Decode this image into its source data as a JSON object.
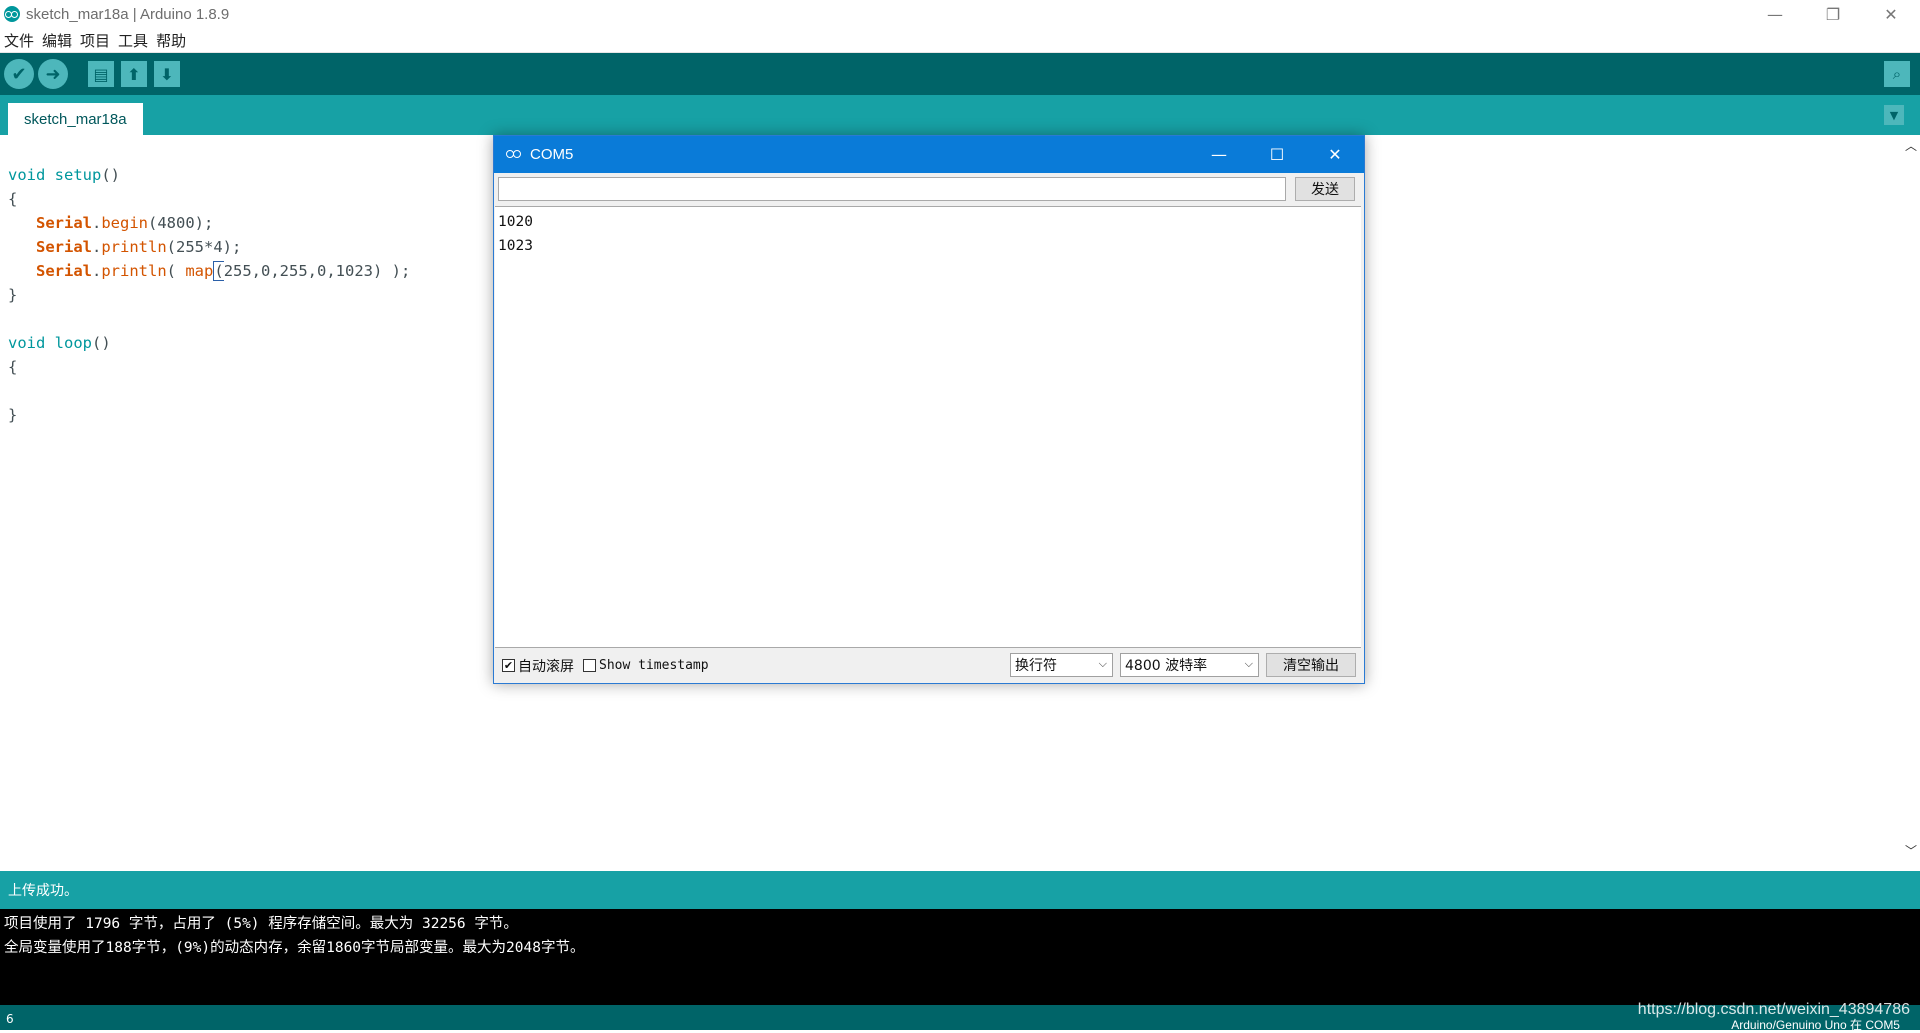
{
  "window": {
    "title": "sketch_mar18a | Arduino 1.8.9",
    "controls": {
      "minimize": "—",
      "restore": "❐",
      "close": "✕"
    }
  },
  "menu": [
    "文件",
    "编辑",
    "项目",
    "工具",
    "帮助"
  ],
  "toolbar": {
    "verify_icon": "check-icon",
    "upload_icon": "arrow-right-icon",
    "new_icon": "new-file-icon",
    "open_icon": "open-arrow-up-icon",
    "save_icon": "save-arrow-down-icon",
    "serial_monitor_icon": "magnifier-icon"
  },
  "tabs": [
    {
      "label": "sketch_mar18a"
    }
  ],
  "editor": {
    "lines": [
      "void setup()",
      "{",
      "   Serial.begin(4800);",
      "   Serial.println(255*4);",
      "   Serial.println( map(255,0,255,0,1023) );",
      "}",
      "",
      "void loop()",
      "{",
      "",
      "}"
    ]
  },
  "serial_monitor": {
    "title": "COM5",
    "send_input_value": "",
    "send_label": "发送",
    "output": [
      "1020",
      "1023"
    ],
    "autoscroll": {
      "label": "自动滚屏",
      "checked": true
    },
    "timestamp": {
      "label": "Show timestamp",
      "checked": false
    },
    "line_ending": "换行符",
    "baud_rate": "4800 波特率",
    "clear_label": "清空输出"
  },
  "status": {
    "message": "上传成功。"
  },
  "console": [
    "项目使用了 1796 字节，占用了 (5%) 程序存储空间。最大为 32256 字节。",
    "全局变量使用了188字节，(9%)的动态内存，余留1860字节局部变量。最大为2048字节。"
  ],
  "footer": {
    "line_number": "6",
    "board": "Arduino/Genuino Uno 在 COM5",
    "watermark": "https://blog.csdn.net/weixin_43894786"
  },
  "colors": {
    "teal_dark": "#006468",
    "teal_mid": "#17a1a5",
    "teal_light": "#4db7bb",
    "keyword_blue": "#00979d",
    "keyword_orange": "#d35400",
    "serial_titlebar": "#0a7bd8"
  }
}
